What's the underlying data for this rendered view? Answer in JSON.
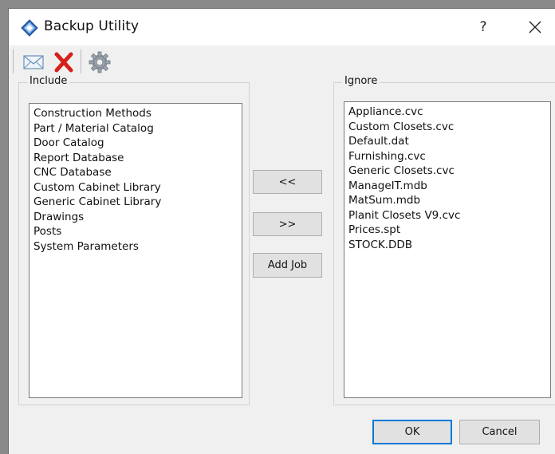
{
  "window": {
    "title": "Backup Utility",
    "help_label": "?"
  },
  "toolbar": {
    "icons": [
      "email-icon",
      "delete-icon",
      "settings-icon"
    ]
  },
  "include": {
    "label": "Include",
    "items": [
      "Construction Methods",
      "Part / Material Catalog",
      "Door Catalog",
      "Report Database",
      "CNC Database",
      "Custom Cabinet Library",
      "Generic Cabinet Library",
      "Drawings",
      "Posts",
      "System Parameters"
    ]
  },
  "ignore": {
    "label": "Ignore",
    "items": [
      "Appliance.cvc",
      "Custom Closets.cvc",
      "Default.dat",
      "Furnishing.cvc",
      "Generic Closets.cvc",
      "ManageIT.mdb",
      "MatSum.mdb",
      "Planit Closets V9.cvc",
      "Prices.spt",
      "STOCK.DDB"
    ]
  },
  "buttons": {
    "move_left": "<<",
    "move_right": ">>",
    "add_job": "Add Job",
    "ok": "OK",
    "cancel": "Cancel"
  },
  "colors": {
    "accent": "#0078d7",
    "delete_red": "#d6201a"
  }
}
